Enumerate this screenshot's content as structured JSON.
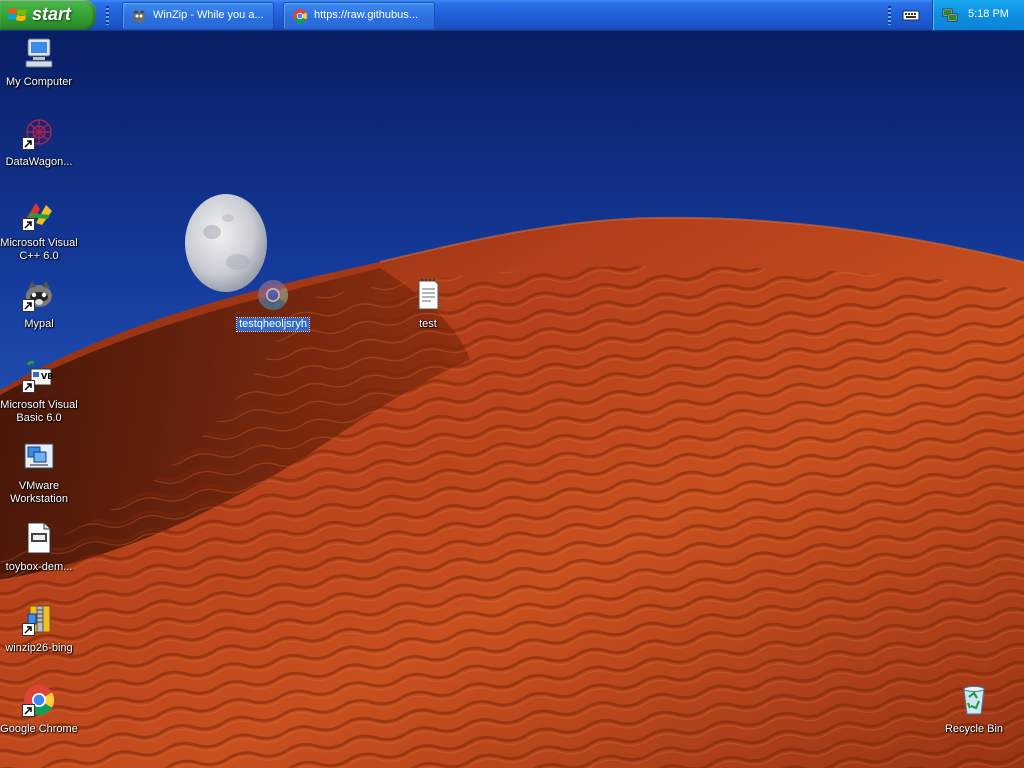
{
  "taskbar": {
    "start_label": "start",
    "tasks": [
      {
        "label": "WinZip - While you a...",
        "icon": "winzip-icon"
      },
      {
        "label": "https://raw.githubus...",
        "icon": "chrome-icon"
      }
    ],
    "clock": "5:18 PM"
  },
  "desktop": {
    "left_icons": [
      {
        "label": "My Computer",
        "icon": "my-computer-icon"
      },
      {
        "label": "DataWagon...",
        "icon": "datawagon-icon",
        "shortcut": true
      },
      {
        "label": "Microsoft Visual C++ 6.0",
        "icon": "visual-cpp-icon",
        "shortcut": true
      },
      {
        "label": "Mypal",
        "icon": "mypal-icon",
        "shortcut": true
      },
      {
        "label": "Microsoft Visual Basic 6.0",
        "icon": "visual-basic-icon",
        "shortcut": true
      },
      {
        "label": "VMware Workstation",
        "icon": "vmware-icon"
      },
      {
        "label": "toybox-dem...",
        "icon": "file-icon"
      },
      {
        "label": "winzip26-bing",
        "icon": "winzip-installer-icon",
        "shortcut": true
      },
      {
        "label": "Google Chrome",
        "icon": "chrome-icon",
        "shortcut": true
      }
    ],
    "selected_icon": {
      "label": "testqheoljsryh",
      "icon": "chrome-icon"
    },
    "text_icon": {
      "label": "test",
      "icon": "text-file-icon"
    },
    "recycle_bin": {
      "label": "Recycle Bin",
      "icon": "recycle-bin-icon"
    }
  },
  "colors": {
    "sky_top": "#071a5c",
    "sky_bottom": "#3a6fd0",
    "dune": "#b8401c",
    "taskbar": "#245edb",
    "start_green": "#3aa83a",
    "selection": "#316ac5"
  }
}
